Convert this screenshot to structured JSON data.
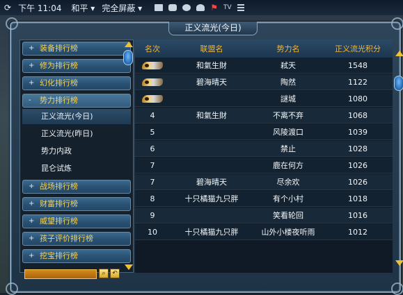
{
  "statusbar": {
    "time": "下午 11:04",
    "mode": "和平",
    "screen": "完全屏蔽",
    "tv": "TV"
  },
  "window": {
    "title": "正义流光(今日)"
  },
  "sidebar": {
    "items": [
      {
        "label": "装备排行榜",
        "sign": "+"
      },
      {
        "label": "修为排行榜",
        "sign": "+"
      },
      {
        "label": "幻化排行榜",
        "sign": "+"
      },
      {
        "label": "势力排行榜",
        "sign": "-"
      },
      {
        "label": "战场排行榜",
        "sign": "+"
      },
      {
        "label": "财富排行榜",
        "sign": "+"
      },
      {
        "label": "威望排行榜",
        "sign": "+"
      },
      {
        "label": "孩子评价排行榜",
        "sign": "+"
      },
      {
        "label": "挖宝排行榜",
        "sign": "+"
      }
    ],
    "subitems": [
      {
        "label": "正义流光(今日)"
      },
      {
        "label": "正义流光(昨日)"
      },
      {
        "label": "势力内政"
      },
      {
        "label": "昆仑试炼"
      }
    ]
  },
  "table": {
    "headers": [
      "名次",
      "联盟名",
      "势力名",
      "正义流光积分"
    ],
    "rows": [
      {
        "rank": "",
        "rank_icon": true,
        "alliance": "和氣生財",
        "faction": "弒天",
        "score": "1548"
      },
      {
        "rank": "",
        "rank_icon": true,
        "alliance": "碧海晴天",
        "faction": "陶然",
        "score": "1122"
      },
      {
        "rank": "",
        "rank_icon": true,
        "alliance": "",
        "faction": "謎城",
        "score": "1080"
      },
      {
        "rank": "4",
        "rank_icon": false,
        "alliance": "和氣生財",
        "faction": "不离不弃",
        "score": "1068"
      },
      {
        "rank": "5",
        "rank_icon": false,
        "alliance": "",
        "faction": "风陵渡口",
        "score": "1039"
      },
      {
        "rank": "6",
        "rank_icon": false,
        "alliance": "",
        "faction": "禁止",
        "score": "1028"
      },
      {
        "rank": "7",
        "rank_icon": false,
        "alliance": "",
        "faction": "鹿在何方",
        "score": "1026"
      },
      {
        "rank": "7",
        "rank_icon": false,
        "alliance": "碧海晴天",
        "faction": "尽余欢",
        "score": "1026"
      },
      {
        "rank": "8",
        "rank_icon": false,
        "alliance": "十只橘猫九只胖",
        "faction": "有个小村",
        "score": "1018"
      },
      {
        "rank": "9",
        "rank_icon": false,
        "alliance": "",
        "faction": "笑看轮回",
        "score": "1016"
      },
      {
        "rank": "10",
        "rank_icon": false,
        "alliance": "十只橘猫九只胖",
        "faction": "山外小楼夜听雨",
        "score": "1012"
      }
    ]
  },
  "colors": {
    "header_text": "#f1b63a",
    "sidebar_text": "#f6d35a",
    "input_fill": "#d48a18"
  }
}
